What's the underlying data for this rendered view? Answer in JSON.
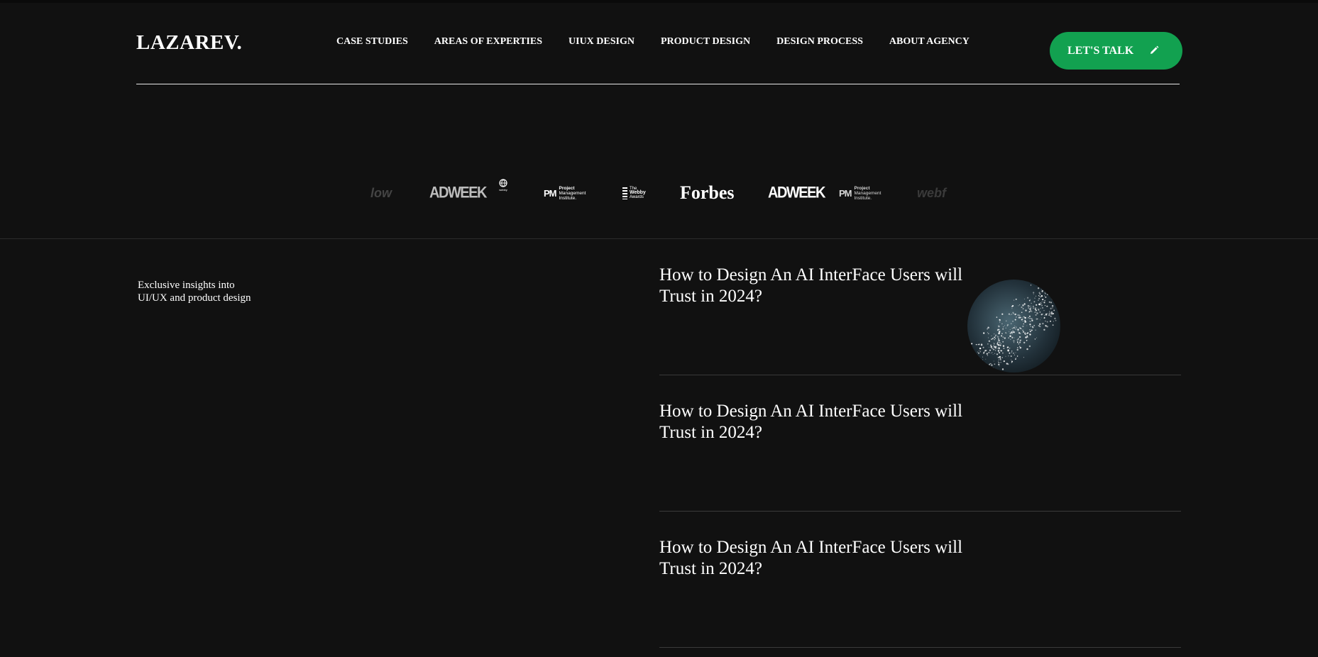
{
  "header": {
    "logo": "LAZAREV.",
    "nav": [
      "CASE STUDIES",
      "AREAS OF EXPERTIES",
      "UIUX DESIGN",
      "PRODUCT DESIGN",
      "DESIGN PROCESS",
      "ABOUT AGENCY"
    ],
    "cta_label": "LET'S TALK",
    "cta_icon": "pencil-icon"
  },
  "brands": {
    "webflow_partial": "low",
    "adweek": "ADWEEK",
    "globe_caption": "webby",
    "pmi_mark": "PM",
    "pmi_line1": "Project",
    "pmi_line2": "Management",
    "pmi_line3": "Institute.",
    "webby_line1": "The",
    "webby_line2": "Webby",
    "webby_line3": "Awards",
    "forbes": "Forbes",
    "webflow_partial_right": "webf"
  },
  "intro": {
    "line1": "Exclusive insights into",
    "line2": "UI/UX and product design"
  },
  "articles": [
    {
      "title": "How to Design An AI InterFace Users will Trust in 2024?"
    },
    {
      "title": "How to Design An AI InterFace Users will Trust in 2024?"
    },
    {
      "title": "How to Design An AI InterFace Users will Trust in 2024?"
    }
  ],
  "colors": {
    "background": "#111111",
    "accent_green": "#12a150",
    "text": "#ffffff"
  }
}
